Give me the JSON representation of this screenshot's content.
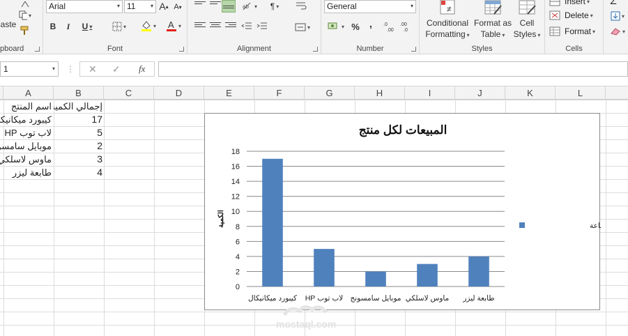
{
  "ribbon": {
    "clipboard": {
      "paste_label": "aste",
      "label": "pboard"
    },
    "font": {
      "name": "Arial",
      "size": "11",
      "bold": "B",
      "italic": "I",
      "underline": "U",
      "grow": "A",
      "shrink": "A",
      "label": "Font"
    },
    "alignment": {
      "label": "Alignment"
    },
    "number": {
      "format": "General",
      "percent": "%",
      "comma": ",",
      "label": "Number"
    },
    "styles": {
      "conditional_line1": "Conditional",
      "conditional_line2": "Formatting",
      "table_line1": "Format as",
      "table_line2": "Table",
      "cell_line1": "Cell",
      "cell_line2": "Styles",
      "label": "Styles"
    },
    "cells": {
      "insert": "Insert",
      "delete": "Delete",
      "format": "Format",
      "label": "Cells"
    }
  },
  "formula_bar": {
    "name_box": "1",
    "cancel": "✕",
    "enter": "✓",
    "fx": "fx",
    "formula": ""
  },
  "columns": [
    "A",
    "B",
    "C",
    "D",
    "E",
    "F",
    "G",
    "H",
    "I",
    "J",
    "K",
    "L"
  ],
  "sheet": {
    "header_a": "اسم المنتج",
    "header_b": "إجمالي الكمية",
    "rows": [
      {
        "name": "كيبورد ميكانيكي",
        "qty": "17"
      },
      {
        "name": "لاب توب HP",
        "qty": "5"
      },
      {
        "name": "موبايل سامسونج",
        "qty": "2"
      },
      {
        "name": "ماوس لاسلكي",
        "qty": "3"
      },
      {
        "name": "طابعة ليزر",
        "qty": "4"
      }
    ]
  },
  "chart_data": {
    "type": "bar",
    "title": "المبيعات لكل منتج",
    "xlabel": "",
    "ylabel": "الكمية",
    "categories": [
      "كيبورد ميكانيكال",
      "لاب توب HP",
      "موبايل سامسونج",
      "ماوس لاسلكي",
      "طابعة ليزر"
    ],
    "series": [
      {
        "name": "إجمالي الكمية المباعة",
        "values": [
          17,
          5,
          2,
          3,
          4
        ],
        "color": "#4f81bd"
      }
    ],
    "ylim": [
      0,
      18
    ],
    "yticks": [
      0,
      2,
      4,
      6,
      8,
      10,
      12,
      14,
      16,
      18
    ],
    "grid": true,
    "legend": "right"
  },
  "watermark": {
    "text": "mostaql.com"
  },
  "colors": {
    "ribbon_bg": "#f3f3f3",
    "bar": "#4f81bd",
    "gridline": "#dcdcdc"
  }
}
